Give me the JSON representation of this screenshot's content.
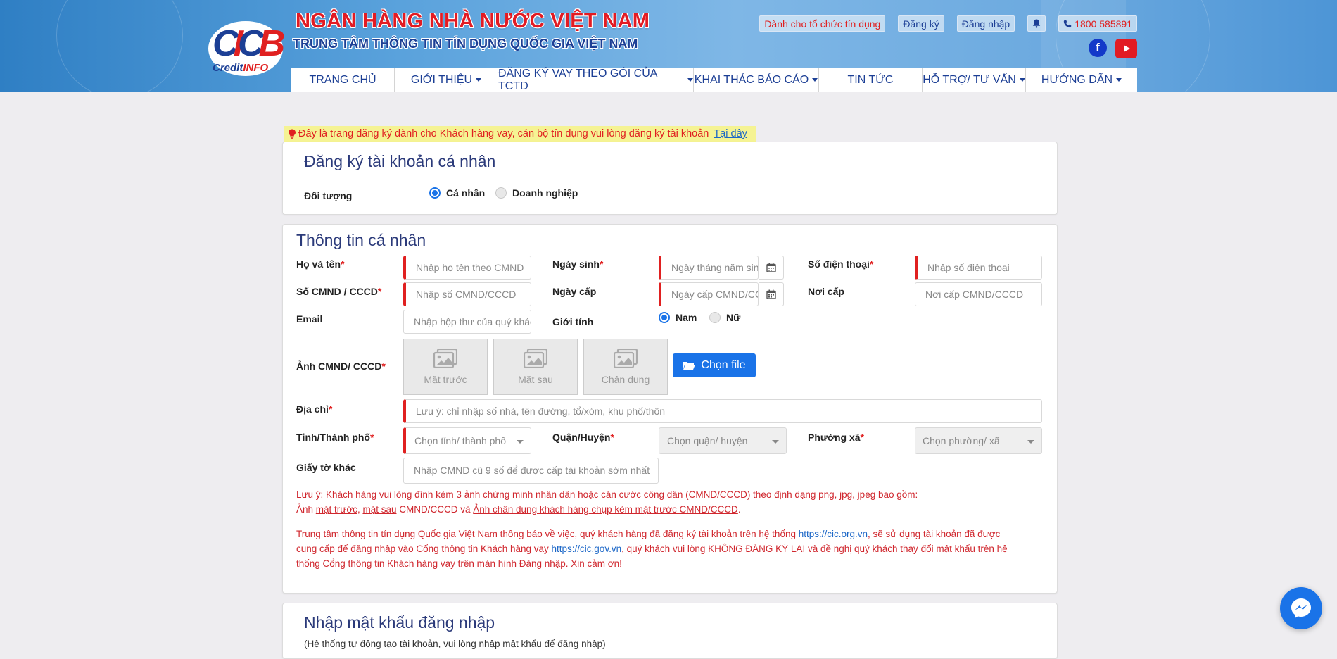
{
  "header": {
    "logo_text": "CICB",
    "logo_sub": [
      "Credit",
      "INFO"
    ],
    "bank_title": "NGÂN HÀNG NHÀ NƯỚC VIỆT NAM",
    "bank_subtitle": "TRUNG TÂM THÔNG TIN TÍN DỤNG QUỐC GIA VIỆT NAM",
    "top_links": {
      "institutions": "Dành cho tổ chức tín dụng",
      "register": "Đăng ký",
      "login": "Đăng nhập",
      "hotline": "1800 585891"
    },
    "nav": [
      {
        "label": "TRANG CHỦ"
      },
      {
        "label": "GIỚI THIỆU"
      },
      {
        "label": "ĐĂNG KÝ VAY THEO GÓI CỦA TCTD"
      },
      {
        "label": "KHAI THÁC BÁO CÁO"
      },
      {
        "label": "TIN TỨC"
      },
      {
        "label": "HỖ TRỢ/ TƯ VẤN"
      },
      {
        "label": "HƯỚNG DẪN"
      }
    ]
  },
  "notice": {
    "text": "Đây là trang đăng ký dành cho Khách hàng vay, cán bộ tín dụng vui lòng đăng ký tài khoản",
    "link": "Tại đây"
  },
  "account_type": {
    "title": "Đăng ký tài khoản cá nhân",
    "label": "Đối tượng",
    "options": [
      "Cá nhân",
      "Doanh nghiệp"
    ],
    "selected": "Cá nhân"
  },
  "personal": {
    "title": "Thông tin cá nhân",
    "full_name": {
      "label": "Họ và tên",
      "placeholder": "Nhập họ tên theo CMND"
    },
    "dob": {
      "label": "Ngày sinh",
      "placeholder": "Ngày tháng năm sinh"
    },
    "phone": {
      "label": "Số điện thoại",
      "placeholder": "Nhập số điện thoại"
    },
    "id_number": {
      "label": "Số CMND / CCCD",
      "placeholder": "Nhập số CMND/CCCD"
    },
    "issue_date": {
      "label": "Ngày cấp",
      "placeholder": "Ngày cấp CMND/CCCD"
    },
    "issue_place": {
      "label": "Nơi cấp",
      "placeholder": "Nơi cấp CMND/CCCD"
    },
    "email": {
      "label": "Email",
      "placeholder": "Nhập hộp thư của quý khách"
    },
    "gender": {
      "label": "Giới tính",
      "options": [
        "Nam",
        "Nữ"
      ],
      "selected": "Nam"
    },
    "id_photos": {
      "label": "Ảnh CMND/ CCCD",
      "front": "Mặt trước",
      "back": "Mặt sau",
      "portrait": "Chân dung",
      "choose_file": "Chọn file"
    },
    "address": {
      "label": "Địa chỉ",
      "placeholder": "Lưu ý: chỉ nhập số nhà, tên đường, tổ/xóm, khu phố/thôn"
    },
    "province": {
      "label": "Tỉnh/Thành phố",
      "placeholder": "Chọn tỉnh/ thành phố"
    },
    "district": {
      "label": "Quận/Huyện",
      "placeholder": "Chọn quận/ huyện"
    },
    "ward": {
      "label": "Phường xã",
      "placeholder": "Chọn phường/ xã"
    },
    "other_docs": {
      "label": "Giấy tờ khác",
      "placeholder": "Nhập CMND cũ 9 số để được cấp tài khoản sớm nhất"
    },
    "note1": {
      "line1": "Lưu ý: Khách hàng vui lòng đính kèm 3 ảnh chứng minh nhân dân hoặc căn cước công dân (CMND/CCCD) theo định dạng png, jpg, jpeg bao gồm:",
      "line2_prefix": "Ảnh ",
      "front": "mặt trước",
      "sep": ", ",
      "back": "mặt sau",
      "mid": " CMND/CCCD và ",
      "portrait": "Ảnh chân dung khách hàng chụp kèm mặt trước CMND/CCCD",
      "end": "."
    },
    "note2": {
      "p1": "Trung tâm thông tin tín dụng Quốc gia Việt Nam thông báo về việc, quý khách hàng đã đăng ký tài khoản trên hệ thống ",
      "link1": "https://cic.org.vn",
      "p2": ", sẽ sử dụng tài khoản đã được",
      "p3": "cung cấp để đăng nhập vào Cổng thông tin Khách hàng vay ",
      "link2": "https://cic.gov.vn",
      "p4": ", quý khách vui lòng ",
      "emph": "KHÔNG ĐĂNG KÝ LẠI",
      "p5": " và đề nghị quý khách thay đổi mật khẩu trên hệ",
      "p6": "thống Cổng thông tin Khách hàng vay trên màn hình Đăng nhập. Xin cảm ơn!"
    }
  },
  "password_section": {
    "title": "Nhập mật khẩu đăng nhập",
    "subtitle": "(Hệ thống tự động tạo tài khoản, vui lòng nhập mật khẩu để đăng nhập)"
  },
  "colors": {
    "brand_blue": "#1c3f95",
    "brand_red": "#e21b23",
    "accent": "#1a73e8"
  }
}
